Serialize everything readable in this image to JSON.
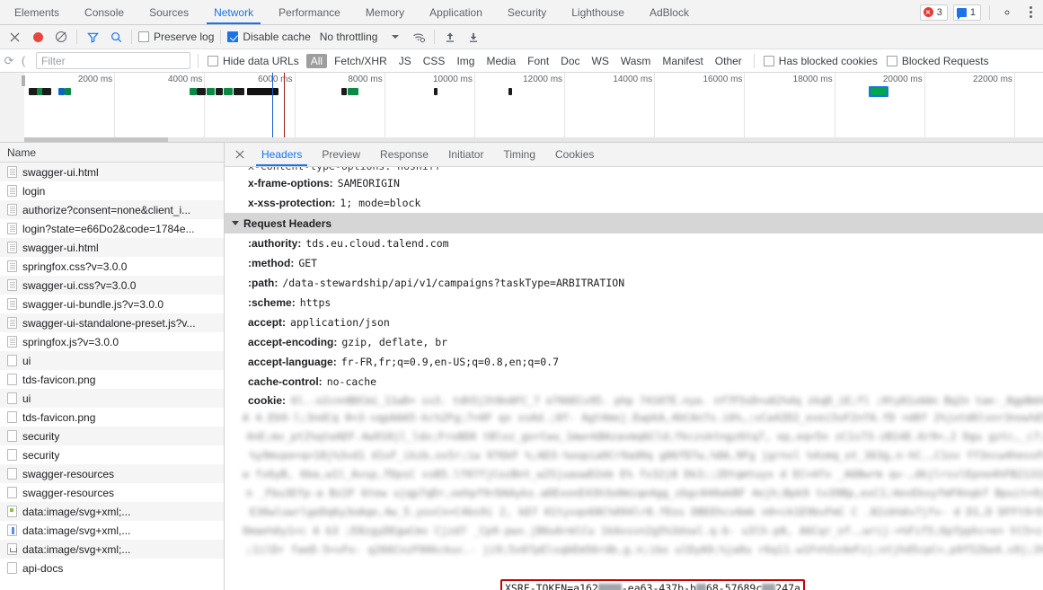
{
  "devtools": {
    "tabs": [
      {
        "label": "Elements",
        "active": false
      },
      {
        "label": "Console",
        "active": false
      },
      {
        "label": "Sources",
        "active": false
      },
      {
        "label": "Network",
        "active": true
      },
      {
        "label": "Performance",
        "active": false
      },
      {
        "label": "Memory",
        "active": false
      },
      {
        "label": "Application",
        "active": false
      },
      {
        "label": "Security",
        "active": false
      },
      {
        "label": "Lighthouse",
        "active": false
      },
      {
        "label": "AdBlock",
        "active": false
      }
    ],
    "error_count": "3",
    "message_count": "1",
    "settings_icon": "gear-icon",
    "more_icon": "kebab-menu-icon",
    "accent_color": "#1a73e8",
    "error_color": "#e53935"
  },
  "toolbar": {
    "close_icon": "close-icon",
    "record_icon": "record-icon",
    "clear_icon": "clear-icon",
    "filter_icon": "filter-funnel-icon",
    "search_icon": "search-icon",
    "preserve_log_label": "Preserve log",
    "preserve_log_checked": false,
    "disable_cache_label": "Disable cache",
    "disable_cache_checked": true,
    "throttling_value": "No throttling",
    "wifi_icon": "wifi-settings-icon",
    "import_icon": "import-har-icon",
    "export_icon": "export-har-icon"
  },
  "filterbar": {
    "refresh_icon": "reload-icon",
    "filter_placeholder": "Filter",
    "filter_value": "",
    "hide_data_urls_label": "Hide data URLs",
    "hide_data_urls_checked": false,
    "type_chips": [
      "All",
      "Fetch/XHR",
      "JS",
      "CSS",
      "Img",
      "Media",
      "Font",
      "Doc",
      "WS",
      "Wasm",
      "Manifest",
      "Other"
    ],
    "selected_chip": "All",
    "has_blocked_cookies_label": "Has blocked cookies",
    "has_blocked_cookies_checked": false,
    "blocked_requests_label": "Blocked Requests",
    "blocked_requests_checked": false
  },
  "overview": {
    "tick_labels": [
      "2000 ms",
      "4000 ms",
      "6000 ms",
      "8000 ms",
      "10000 ms",
      "12000 ms",
      "14000 ms",
      "16000 ms",
      "18000 ms",
      "20000 ms",
      "22000 ms"
    ],
    "dom_content_loaded_color": "#1a5fd0",
    "load_event_color": "#9b1c1c",
    "selected_bar_color": "#00a550",
    "selected_bar_border": "#1a73e8"
  },
  "requests": {
    "column_header": "Name",
    "rows": [
      {
        "name": "swagger-ui.html",
        "icon": "document-icon"
      },
      {
        "name": "login",
        "icon": "document-icon"
      },
      {
        "name": "authorize?consent=none&client_i...",
        "icon": "document-icon"
      },
      {
        "name": "login?state=e66Do2&code=1784e...",
        "icon": "document-icon"
      },
      {
        "name": "swagger-ui.html",
        "icon": "document-icon"
      },
      {
        "name": "springfox.css?v=3.0.0",
        "icon": "document-icon"
      },
      {
        "name": "swagger-ui.css?v=3.0.0",
        "icon": "document-icon"
      },
      {
        "name": "swagger-ui-bundle.js?v=3.0.0",
        "icon": "document-icon"
      },
      {
        "name": "swagger-ui-standalone-preset.js?v...",
        "icon": "document-icon"
      },
      {
        "name": "springfox.js?v=3.0.0",
        "icon": "document-icon"
      },
      {
        "name": "ui",
        "icon": "blank-file-icon"
      },
      {
        "name": "tds-favicon.png",
        "icon": "blank-file-icon"
      },
      {
        "name": "ui",
        "icon": "blank-file-icon"
      },
      {
        "name": "tds-favicon.png",
        "icon": "blank-file-icon"
      },
      {
        "name": "security",
        "icon": "blank-file-icon"
      },
      {
        "name": "security",
        "icon": "blank-file-icon"
      },
      {
        "name": "swagger-resources",
        "icon": "blank-file-icon"
      },
      {
        "name": "swagger-resources",
        "icon": "blank-file-icon"
      },
      {
        "name": "data:image/svg+xml;...",
        "icon": "svg-image-icon"
      },
      {
        "name": "data:image/svg+xml,...",
        "icon": "svg-image-icon"
      },
      {
        "name": "data:image/svg+xml;...",
        "icon": "svg-image-icon"
      },
      {
        "name": "api-docs",
        "icon": "blank-file-icon"
      }
    ]
  },
  "details": {
    "close_icon": "close-icon",
    "tabs": [
      {
        "label": "Headers",
        "active": true
      },
      {
        "label": "Preview",
        "active": false
      },
      {
        "label": "Response",
        "active": false
      },
      {
        "label": "Initiator",
        "active": false
      },
      {
        "label": "Timing",
        "active": false
      },
      {
        "label": "Cookies",
        "active": false
      }
    ],
    "response_headers_visible": [
      {
        "name": "x-frame-options:",
        "value": "SAMEORIGIN"
      },
      {
        "name": "x-xss-protection:",
        "value": "1; mode=block"
      }
    ],
    "request_headers_section": "Request Headers",
    "request_headers": [
      {
        "name": ":authority:",
        "value": "tds.eu.cloud.talend.com"
      },
      {
        "name": ":method:",
        "value": "GET"
      },
      {
        "name": ":path:",
        "value": "/data-stewardship/api/v1/campaigns?taskType=ARBITRATION"
      },
      {
        "name": ":scheme:",
        "value": "https"
      },
      {
        "name": "accept:",
        "value": "application/json"
      },
      {
        "name": "accept-encoding:",
        "value": "gzip, deflate, br"
      },
      {
        "name": "accept-language:",
        "value": "fr-FR,fr;q=0.9,en-US;q=0.8,en;q=0.7"
      },
      {
        "name": "cache-control:",
        "value": "no-cache"
      }
    ],
    "cookie_header_name": "cookie:",
    "cookie_value_redacted": true,
    "highlight": {
      "prefix": "XSRF-TOKEN=a162",
      "mid1": "-ea63-437b-b",
      "mid2": "68-57689c",
      "suffix": "247a",
      "border_color": "#cc0000"
    }
  }
}
